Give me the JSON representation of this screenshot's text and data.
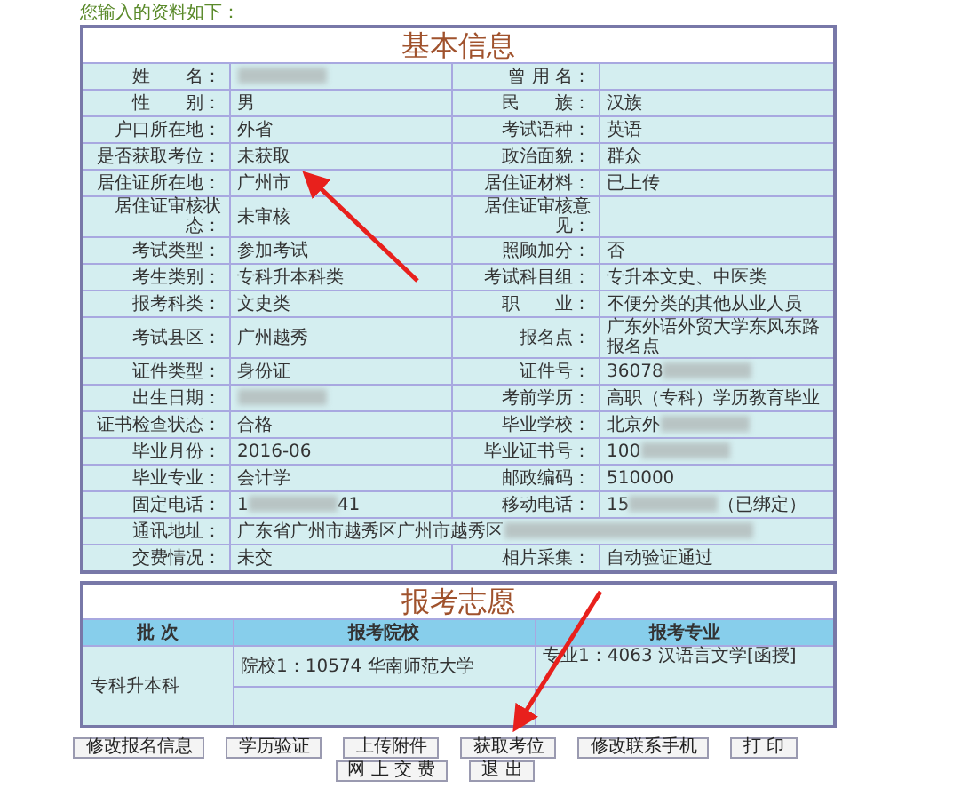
{
  "intro": "您输入的资料如下：",
  "basic": {
    "title": "基本信息",
    "rows": [
      {
        "cells": [
          {
            "label": "姓　　名：",
            "redacted": true
          },
          {
            "label": "曾 用 名："
          }
        ]
      },
      {
        "cells": [
          {
            "label": "性　　别：",
            "value": "男"
          },
          {
            "label": "民　　族：",
            "value": "汉族"
          }
        ]
      },
      {
        "cells": [
          {
            "label": "户口所在地：",
            "value": "外省"
          },
          {
            "label": "考试语种：",
            "value": "英语"
          }
        ]
      },
      {
        "cells": [
          {
            "label": "是否获取考位：",
            "value": "未获取"
          },
          {
            "label": "政治面貌：",
            "value": "群众"
          }
        ]
      },
      {
        "cells": [
          {
            "label": "居住证所在地：",
            "value": "广州市"
          },
          {
            "label": "居住证材料：",
            "value": "已上传"
          }
        ]
      },
      {
        "cells": [
          {
            "label": "居住证审核状态：",
            "value": "未审核"
          },
          {
            "label": "居住证审核意见："
          }
        ]
      },
      {
        "cells": [
          {
            "label": "考试类型：",
            "value": "参加考试"
          },
          {
            "label": "照顾加分：",
            "value": "否"
          }
        ]
      },
      {
        "cells": [
          {
            "label": "考生类别：",
            "value": "专科升本科类"
          },
          {
            "label": "考试科目组：",
            "value": "专升本文史、中医类"
          }
        ]
      },
      {
        "cells": [
          {
            "label": "报考科类：",
            "value": "文史类"
          },
          {
            "label": "职　　业：",
            "value": "不便分类的其他从业人员"
          }
        ]
      },
      {
        "cells": [
          {
            "label": "考试县区：",
            "value": "广州越秀"
          },
          {
            "label": "报名点：",
            "value": "广东外语外贸大学东风东路报名点"
          }
        ]
      },
      {
        "cells": [
          {
            "label": "证件类型：",
            "value": "身份证"
          },
          {
            "label": "证件号：",
            "value": "36078",
            "redacted": true
          }
        ]
      },
      {
        "cells": [
          {
            "label": "出生日期：",
            "redacted": true
          },
          {
            "label": "考前学历：",
            "value": "高职（专科）学历教育毕业"
          }
        ]
      },
      {
        "cells": [
          {
            "label": "证书检查状态：",
            "value": "合格"
          },
          {
            "label": "毕业学校：",
            "value": "北京外",
            "redacted": true
          }
        ]
      },
      {
        "cells": [
          {
            "label": "毕业月份：",
            "value": "2016-06"
          },
          {
            "label": "毕业证书号：",
            "value": "100",
            "redacted": true
          }
        ]
      },
      {
        "cells": [
          {
            "label": "毕业专业：",
            "value": "会计学"
          },
          {
            "label": "邮政编码：",
            "value": "510000"
          }
        ]
      },
      {
        "cells": [
          {
            "label": "固定电话：",
            "value": "1",
            "redacted": true,
            "suffix": "41"
          },
          {
            "label": "移动电话：",
            "value": "15",
            "redacted": true,
            "suffix": "（已绑定）"
          }
        ]
      },
      {
        "cells": [
          {
            "label": "通讯地址：",
            "value": "广东省广州市越秀区广州市越秀区",
            "redacted": true,
            "wide": true
          }
        ]
      },
      {
        "cells": [
          {
            "label": "交费情况：",
            "value": "未交"
          },
          {
            "label": "相片采集：",
            "value": "自动验证通过"
          }
        ]
      }
    ]
  },
  "choices": {
    "title": "报考志愿",
    "columns": [
      "批 次",
      "报考院校",
      "报考专业"
    ],
    "batch": "专科升本科",
    "school": "院校1：10574  华南师范大学",
    "major": "专业1：4063 汉语言文学[函授]"
  },
  "buttons": [
    [
      "修改报名信息",
      "学历验证",
      "上传附件",
      "获取考位",
      "修改联系手机",
      "打 印"
    ],
    [
      "网 上 交 费",
      "退 出"
    ]
  ]
}
